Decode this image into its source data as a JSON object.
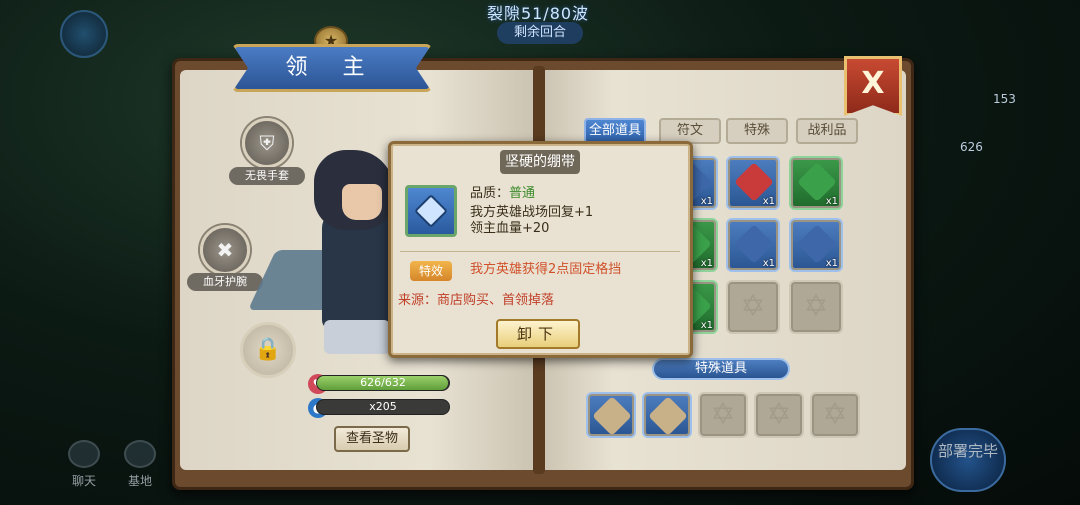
{
  "hud": {
    "wave": "裂隙51/80波",
    "wave_sub": "剩余回合",
    "right_count": "153",
    "right_hp": "626",
    "deploy_button": "部署完毕",
    "bottom": [
      {
        "label": "聊天",
        "icon": "chat-icon"
      },
      {
        "label": "基地",
        "icon": "base-icon"
      }
    ]
  },
  "lord_panel": {
    "title": "领 主",
    "equip_slots": [
      {
        "label": "无畏手套",
        "icon": "gauntlet-icon"
      },
      {
        "label": "血牙护腕",
        "icon": "bracer-icon"
      }
    ],
    "hp_text": "626/632",
    "hp_fraction": 0.99,
    "mana_text": "x205",
    "view_button": "查看圣物"
  },
  "inventory": {
    "tabs": [
      "全部道具",
      "符文",
      "特殊",
      "战利品"
    ],
    "active_tab": 0,
    "close_label": "X",
    "items": [
      {
        "count": "x1",
        "color": "#3d67a8",
        "icon": "scroll-icon"
      },
      {
        "count": "x1",
        "color": "#c93a3a",
        "icon": "sword-rune-icon"
      },
      {
        "count": "x1",
        "color": "#3aa04a",
        "icon": "shield-rune-icon"
      },
      {
        "count": "x1",
        "color": "#3aa04a",
        "icon": "rune-icon"
      },
      {
        "count": "x1",
        "color": "#3d67a8",
        "icon": "chest-icon"
      },
      {
        "count": "x1",
        "color": "#3d67a8",
        "icon": "armor-icon"
      },
      {
        "count": "x1",
        "color": "#3aa04a",
        "icon": "rune-icon"
      }
    ],
    "special_header": "特殊道具",
    "special_count": 2
  },
  "tooltip": {
    "title": "坚硬的绷带",
    "quality_label": "品质：",
    "quality_value": "普通",
    "stat1": "我方英雄战场回复+1",
    "stat2": "领主血量+20",
    "effect_tag": "特效",
    "effect_text": "我方英雄获得2点固定格挡",
    "source": "来源：商店购买、首领掉落",
    "unequip_button": "卸下"
  }
}
